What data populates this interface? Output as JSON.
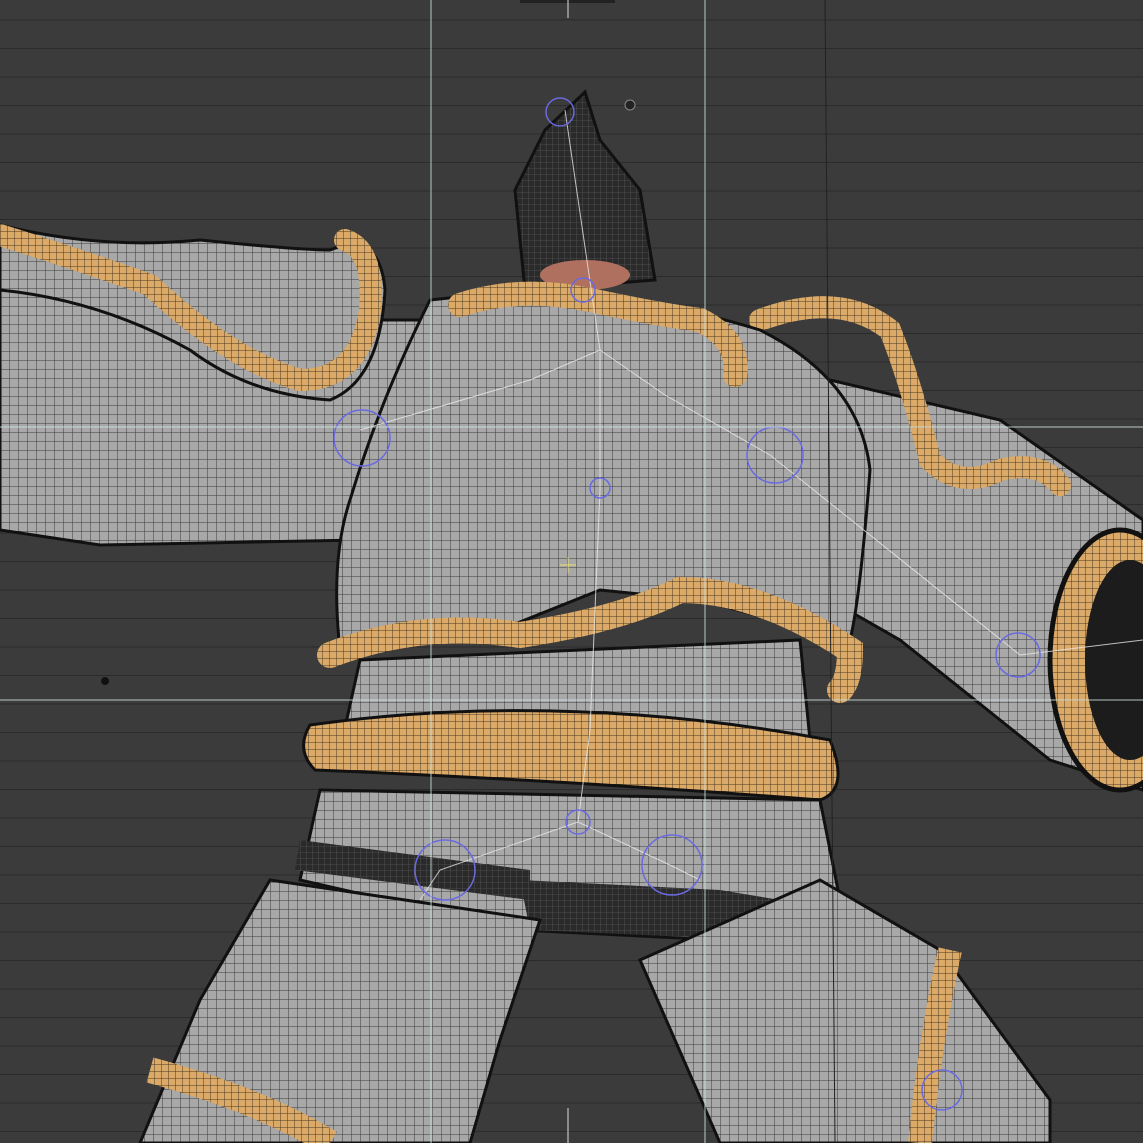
{
  "viewport": {
    "mode": "wireframe-on-shaded",
    "colors": {
      "background": "#3b3b3b",
      "grid_line": "#2b2b2b",
      "guide_line": "#cfe3e3",
      "armor": "#a4a4a4",
      "armor_dark": "#2a2a2a",
      "trim_gold": "#d9a866",
      "bone": "#e8e8e8",
      "joint": "#5a5ad8"
    }
  }
}
